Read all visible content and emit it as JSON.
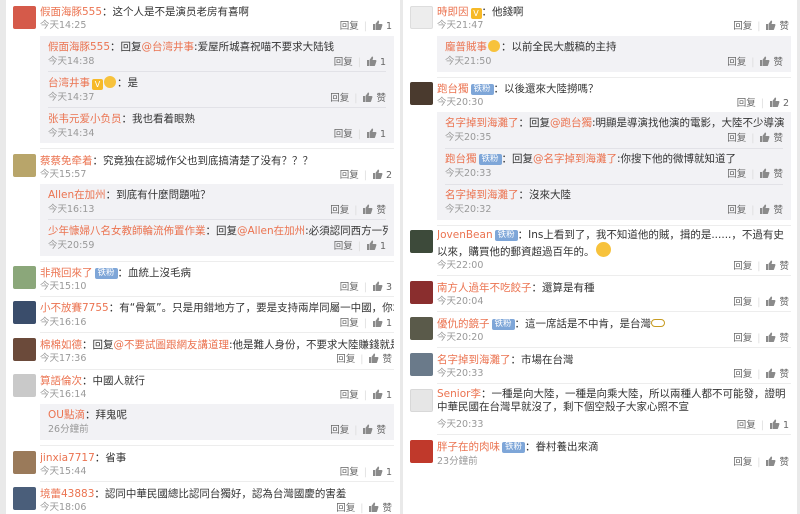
{
  "labels": {
    "reply": "回复",
    "like": "赞"
  },
  "badge": "铁粉",
  "left": {
    "c1": {
      "name": "假面海豚555",
      "text": "这个人是不是演员老房有喜啊",
      "time": "今天14:25",
      "likes": "1"
    },
    "c1_r1": {
      "name": "假面海豚555",
      "pre": "回复",
      "mention": "@台湾井事",
      "text": ":爱屋所城喜祝喵不要求大陆钱",
      "time": "今天14:38",
      "likes": "1"
    },
    "c1_r2": {
      "name": "台湾井事",
      "vip": "V",
      "text": "是",
      "time": "今天14:37",
      "likes": "赞"
    },
    "c1_r3": {
      "name": "张韦元爱小负员",
      "text": "我也看着眼熟",
      "time": "今天14:34",
      "likes": "1"
    },
    "c2": {
      "name": "蔡蔡免牵着",
      "text": "究竟独在認城作父也到底搞清楚了没有？？？",
      "time": "今天15:57",
      "likes": "2"
    },
    "c2_r1": {
      "name": "Allen在加州",
      "text": "到底有什麼問題啦？",
      "time": "今天16:13",
      "likes": "赞"
    },
    "c2_r2": {
      "name": "少年慷婦八名女教師輪流佈置作業",
      "pre": "回复",
      "mention": "@Allen在加州",
      "text": ":必須認同西方一列思想！",
      "time": "今天20:59",
      "likes": "1"
    },
    "c3": {
      "name": "非飛回來了",
      "badge": true,
      "text": "血統上沒毛病",
      "time": "今天15:10",
      "likes": "3"
    },
    "c4": {
      "name": "小不放賽7755",
      "text": "有“骨氣”。只是用錯地方了，要是支持兩岸同屬一中國，你才是真正英雄！",
      "time": "今天16:16",
      "likes": "1"
    },
    "c5": {
      "name": "棉棉如德",
      "pre": "回复",
      "mention": "@不要試圖跟網友講道理",
      "text": ":他是難人身份，不要求大陸賺錢就是了，也不損失什麼",
      "time": "今天17:36",
      "likes": "赞"
    },
    "c6": {
      "name": "算語倫次",
      "text": "中國人就行",
      "time": "今天16:14",
      "likes": "1"
    },
    "c6_r1": {
      "name": "OU點滴",
      "text": "拜鬼呢",
      "time": "26分鐘前",
      "likes": "赞"
    },
    "c7": {
      "name": "jinxia7717",
      "text": "省事",
      "time": "今天15:44",
      "likes": "1"
    },
    "c8": {
      "name": "境蕾43883",
      "text": "認同中華民國總比認同台獨好，認為台灣國慶的害羞",
      "time": "今天18:06",
      "likes": "赞"
    }
  },
  "right": {
    "r1": {
      "name": "時即因",
      "vip": "V",
      "text": "他錢啊",
      "time": "今天21:47",
      "likes": "赞"
    },
    "r1_r1": {
      "name": "龐普賊事",
      "text": "以前全民大戲稿的主持",
      "time": "今天21:50",
      "likes": "赞"
    },
    "r2": {
      "name": "跑台獨",
      "badge": true,
      "text": "以後還來大陸撈嗎？",
      "time": "今天20:30",
      "likes": "2"
    },
    "r2_r1": {
      "name": "名字掉到海灘了",
      "pre": "回复",
      "mention": "@跑台獨",
      "text": ":明顯是導演找他演的電影，大陸不少導演就這死樣。",
      "time": "今天20:35",
      "likes": "赞"
    },
    "r2_r2": {
      "name": "跑台獨",
      "badge": true,
      "pre": "回复",
      "mention": "@名字掉到海灘了",
      "text": ":你搜下他的微博就知道了",
      "time": "今天20:33",
      "likes": "赞"
    },
    "r2_r3": {
      "name": "名字掉到海灘了",
      "text": "沒來大陸",
      "time": "今天20:32",
      "likes": "赞"
    },
    "r3": {
      "name": "JovenBean",
      "badge": true,
      "text": "Ins上看到了，我不知道他的賊，揖的是......，不過有史以來，購買他的郵資超過百年的。",
      "time": "今天22:00",
      "likes": "赞"
    },
    "r4": {
      "name": "南方人過年不吃餃子",
      "text": "還算是有種",
      "time": "今天20:04",
      "likes": "赞"
    },
    "r5": {
      "name": "優仇的鏡子",
      "badge": true,
      "text": "這一席話是不中肯，是台灣",
      "time": "今天20:20",
      "likes": "赞"
    },
    "r6": {
      "name": "名字掉到海灘了",
      "text": "市場在台灣",
      "time": "今天20:33",
      "likes": "赞"
    },
    "r7": {
      "name": "Senior李",
      "text": "一種是向大陸，一種是向乘大陸，所以兩種人都不可能發，證明中華民國在台灣早就沒了，剩下個空殼子大家心照不宣",
      "time": "今天20:33",
      "likes": "1"
    },
    "r8": {
      "name": "胖子在的肉味",
      "badge": true,
      "text": "眷村養出來滴",
      "time": "23分鐘前",
      "likes": "赞"
    }
  }
}
